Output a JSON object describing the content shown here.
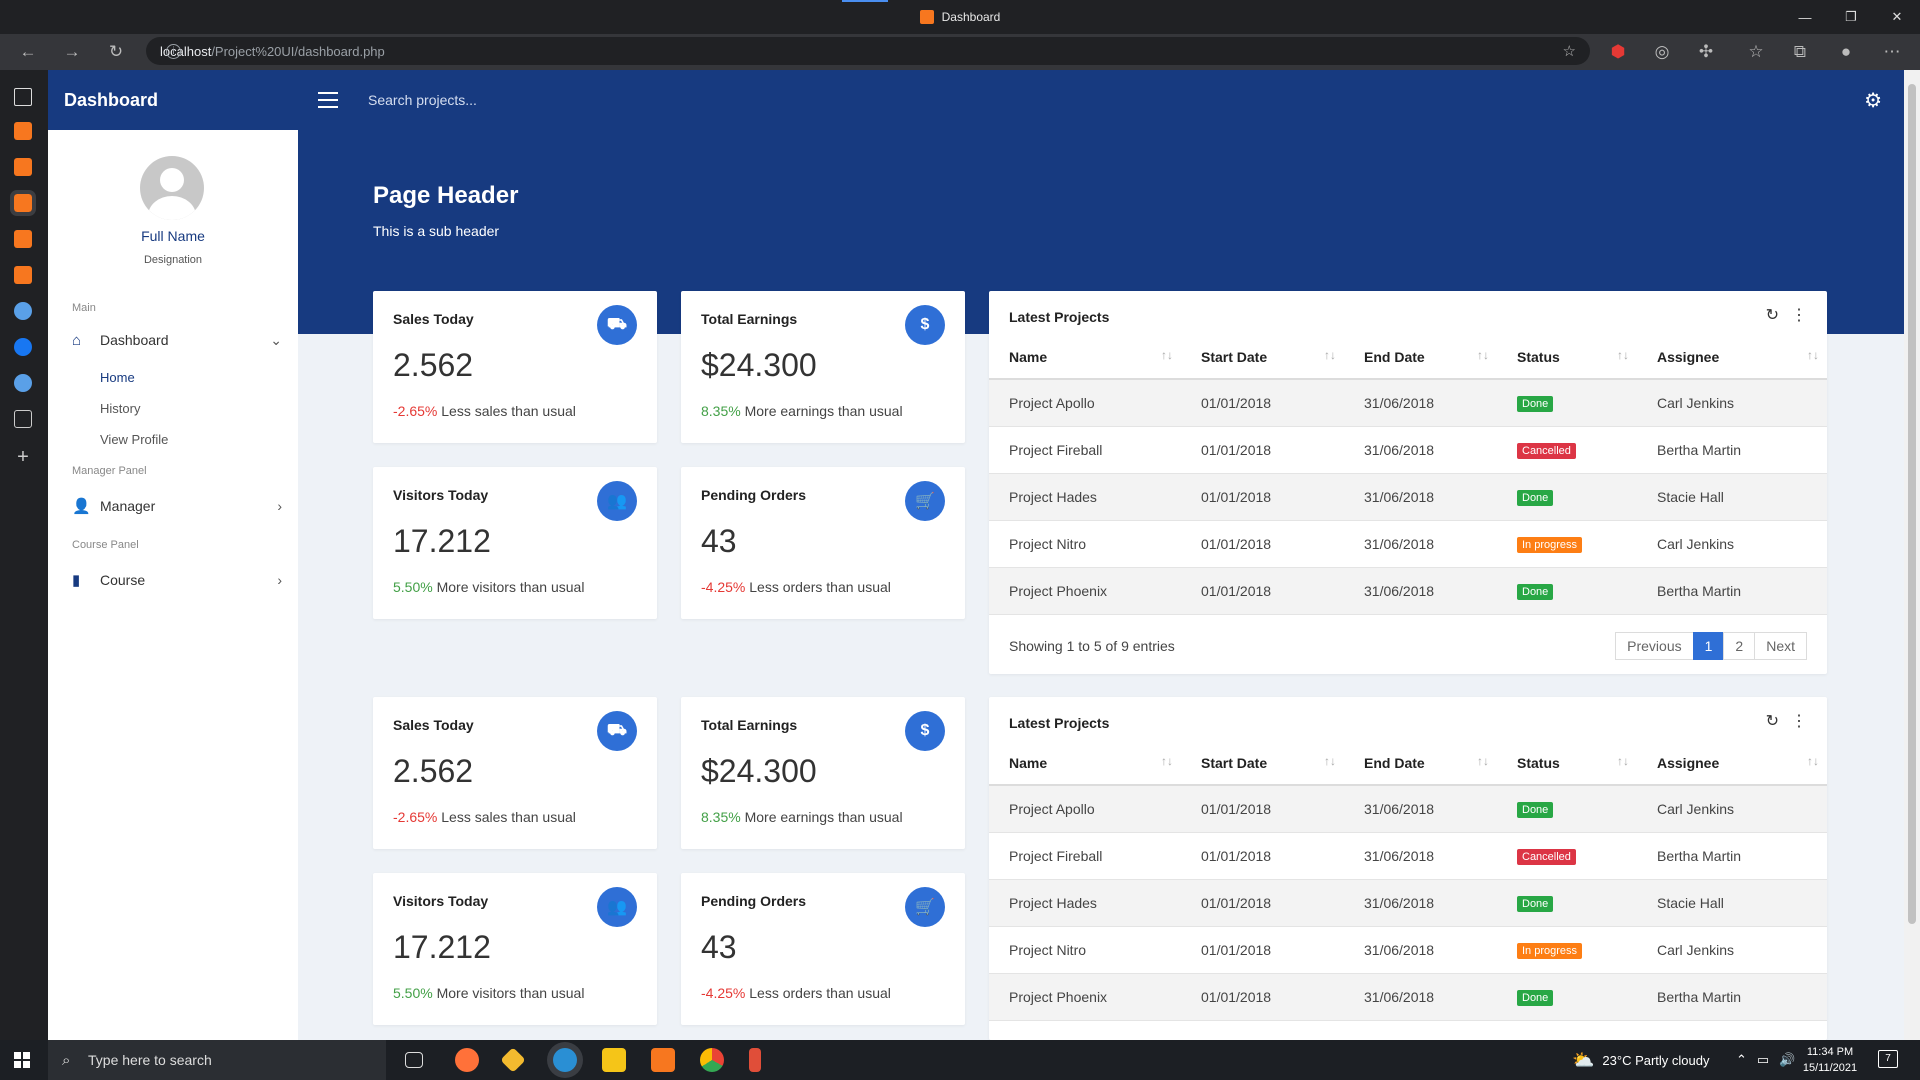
{
  "browser": {
    "tab_title": "Dashboard",
    "url_host": "localhost",
    "url_path": "/Project%20UI/dashboard.php"
  },
  "sidebar": {
    "brand": "Dashboard",
    "full_name": "Full Name",
    "designation": "Designation",
    "sections": {
      "main": "Main",
      "manager": "Manager Panel",
      "course": "Course Panel"
    },
    "dashboard_label": "Dashboard",
    "sub_items": [
      "Home",
      "History",
      "View Profile"
    ],
    "manager_label": "Manager",
    "course_label": "Course"
  },
  "topbar": {
    "search_placeholder": "Search projects..."
  },
  "header": {
    "title": "Page Header",
    "subtitle": "This is a sub header"
  },
  "stats": [
    {
      "title": "Sales Today",
      "icon": "truck-icon",
      "value": "2.562",
      "change": "-2.65%",
      "change_type": "negative",
      "note": "Less sales than usual"
    },
    {
      "title": "Total Earnings",
      "icon": "dollar-icon",
      "value": "$24.300",
      "change": "8.35%",
      "change_type": "positive",
      "note": "More earnings than usual"
    },
    {
      "title": "Visitors Today",
      "icon": "users-icon",
      "value": "17.212",
      "change": "5.50%",
      "change_type": "positive",
      "note": "More visitors than usual"
    },
    {
      "title": "Pending Orders",
      "icon": "cart-icon",
      "value": "43",
      "change": "-4.25%",
      "change_type": "negative",
      "note": "Less orders than usual"
    }
  ],
  "projects": {
    "title": "Latest Projects",
    "columns": [
      "Name",
      "Start Date",
      "End Date",
      "Status",
      "Assignee"
    ],
    "rows": [
      {
        "name": "Project Apollo",
        "start": "01/01/2018",
        "end": "31/06/2018",
        "status": "Done",
        "assignee": "Carl Jenkins"
      },
      {
        "name": "Project Fireball",
        "start": "01/01/2018",
        "end": "31/06/2018",
        "status": "Cancelled",
        "assignee": "Bertha Martin"
      },
      {
        "name": "Project Hades",
        "start": "01/01/2018",
        "end": "31/06/2018",
        "status": "Done",
        "assignee": "Stacie Hall"
      },
      {
        "name": "Project Nitro",
        "start": "01/01/2018",
        "end": "31/06/2018",
        "status": "In progress",
        "assignee": "Carl Jenkins"
      },
      {
        "name": "Project Phoenix",
        "start": "01/01/2018",
        "end": "31/06/2018",
        "status": "Done",
        "assignee": "Bertha Martin"
      }
    ],
    "info": "Showing 1 to 5 of 9 entries",
    "pagination": {
      "previous": "Previous",
      "pages": [
        "1",
        "2"
      ],
      "next": "Next"
    }
  },
  "taskbar": {
    "search_placeholder": "Type here to search",
    "weather": "23°C  Partly cloudy",
    "time": "11:34 PM",
    "date": "15/11/2021",
    "notifications": "7"
  },
  "colors": {
    "primary": "#173a80",
    "accent": "#2f6fd6",
    "done": "#28a745",
    "cancelled": "#dc3545",
    "in_progress": "#fd7e14"
  }
}
